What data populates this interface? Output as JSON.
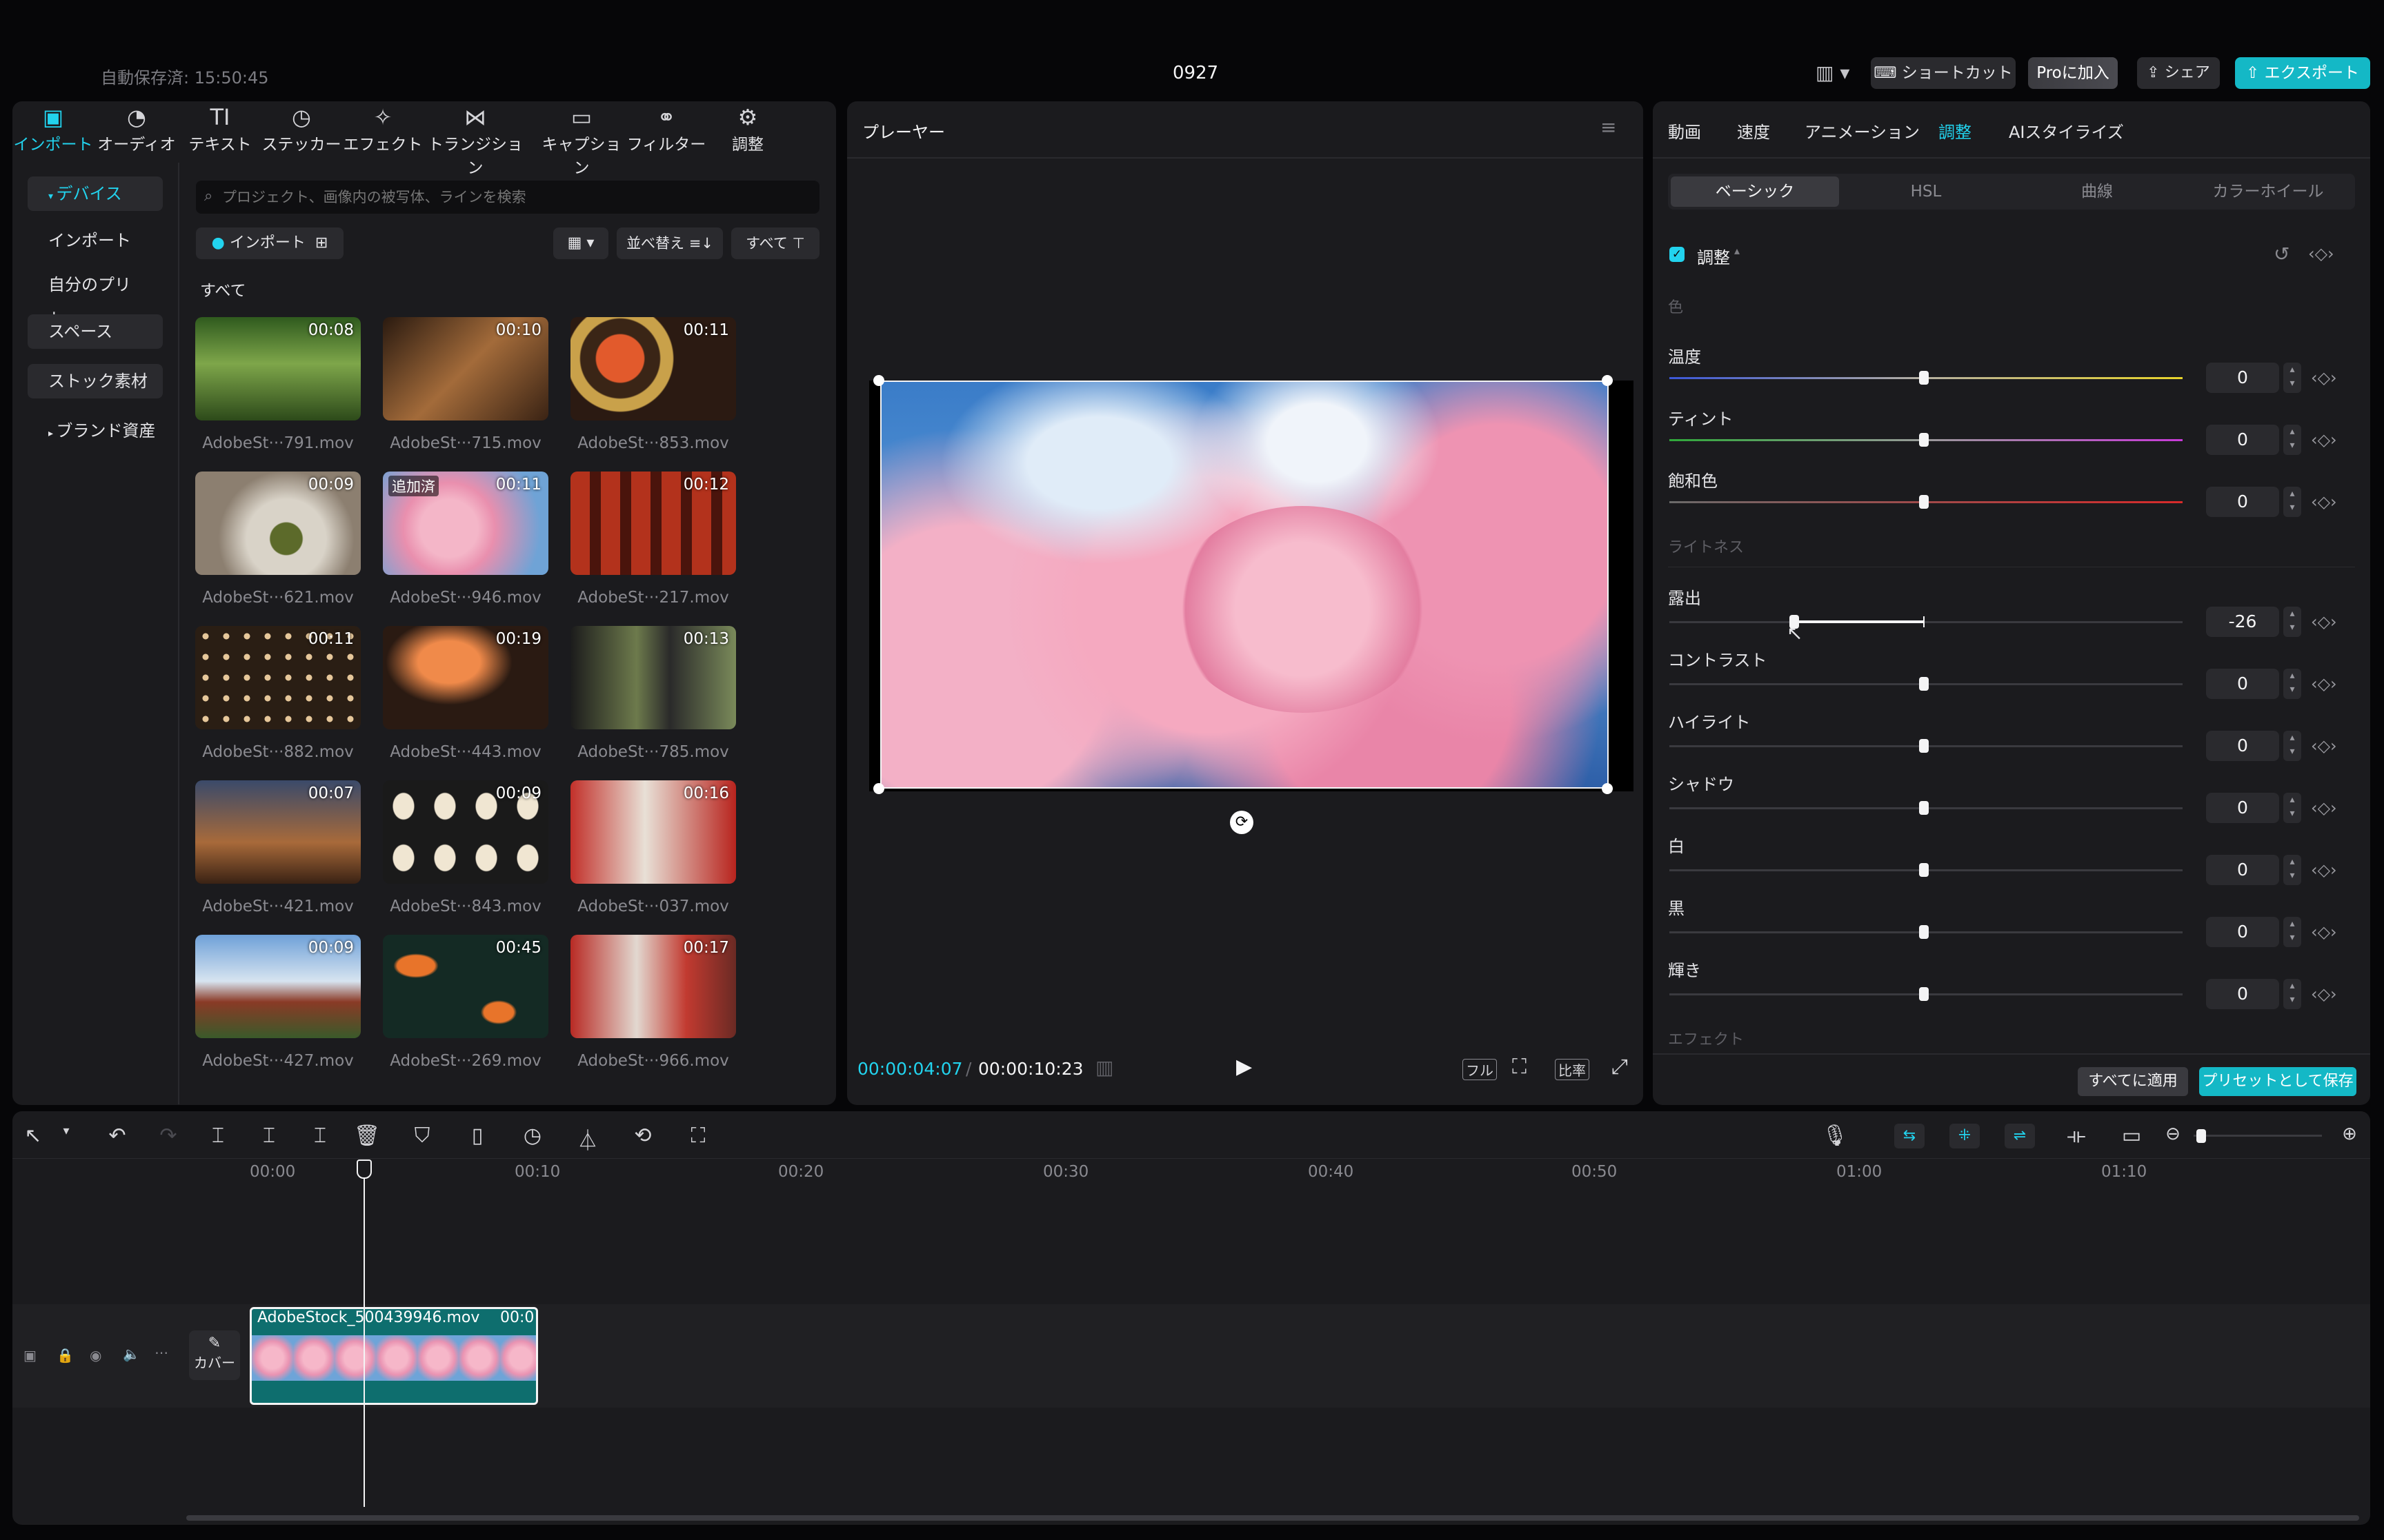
{
  "topbar": {
    "autosave": "自動保存済: 15:50:45",
    "project_name": "0927",
    "shortcut_label": "ショートカット",
    "pro_label": "Proに加入",
    "share_label": "シェア",
    "export_label": "エクスポート"
  },
  "tool_tabs": [
    {
      "label": "インポート",
      "icon": "import-icon"
    },
    {
      "label": "オーディオ",
      "icon": "audio-icon"
    },
    {
      "label": "テキスト",
      "icon": "text-icon"
    },
    {
      "label": "ステッカー",
      "icon": "sticker-icon"
    },
    {
      "label": "エフェクト",
      "icon": "effects-icon"
    },
    {
      "label": "トランジション",
      "icon": "transition-icon"
    },
    {
      "label": "キャプション",
      "icon": "caption-icon"
    },
    {
      "label": "フィルター",
      "icon": "filter-icon"
    },
    {
      "label": "調整",
      "icon": "adjust-icon"
    }
  ],
  "sidebar": {
    "items": [
      {
        "label": "デバイス"
      },
      {
        "label": "インポート"
      },
      {
        "label": "自分のプリセ…"
      },
      {
        "label": "スペース"
      },
      {
        "label": "ストック素材"
      },
      {
        "label": "ブランド資産"
      }
    ]
  },
  "media": {
    "search_placeholder": "プロジェクト、画像内の被写体、ラインを検索",
    "import_label": "インポート",
    "sort_label": "並べ替え",
    "filter_label": "すべて",
    "section_title": "すべて",
    "added_badge": "追加済",
    "items": [
      {
        "name": "AdobeSt···791.mov",
        "duration": "00:08"
      },
      {
        "name": "AdobeSt···715.mov",
        "duration": "00:10"
      },
      {
        "name": "AdobeSt···853.mov",
        "duration": "00:11"
      },
      {
        "name": "AdobeSt···621.mov",
        "duration": "00:09"
      },
      {
        "name": "AdobeSt···946.mov",
        "duration": "00:11"
      },
      {
        "name": "AdobeSt···217.mov",
        "duration": "00:12"
      },
      {
        "name": "AdobeSt···882.mov",
        "duration": "00:11"
      },
      {
        "name": "AdobeSt···443.mov",
        "duration": "00:19"
      },
      {
        "name": "AdobeSt···785.mov",
        "duration": "00:13"
      },
      {
        "name": "AdobeSt···421.mov",
        "duration": "00:07"
      },
      {
        "name": "AdobeSt···843.mov",
        "duration": "00:09"
      },
      {
        "name": "AdobeSt···037.mov",
        "duration": "00:16"
      },
      {
        "name": "AdobeSt···427.mov",
        "duration": "00:09"
      },
      {
        "name": "AdobeSt···269.mov",
        "duration": "00:45"
      },
      {
        "name": "AdobeSt···966.mov",
        "duration": "00:17"
      }
    ]
  },
  "player": {
    "title": "プレーヤー",
    "current_time": "00:00:04:07",
    "total_time": "00:00:10:23",
    "full_label": "フル",
    "ratio_label": "比率"
  },
  "inspector": {
    "tabs": [
      "動画",
      "速度",
      "アニメーション",
      "調整",
      "AIスタイライズ"
    ],
    "active_tab": "調整",
    "subtabs": [
      "ベーシック",
      "HSL",
      "曲線",
      "カラーホイール"
    ],
    "active_subtab": "ベーシック",
    "adjust_title": "調整",
    "section_color": "色",
    "section_lightness": "ライトネス",
    "section_effect": "エフェクト",
    "sliders": [
      {
        "label": "温度",
        "value": "0"
      },
      {
        "label": "ティント",
        "value": "0"
      },
      {
        "label": "飽和色",
        "value": "0"
      },
      {
        "label": "露出",
        "value": "-26"
      },
      {
        "label": "コントラスト",
        "value": "0"
      },
      {
        "label": "ハイライト",
        "value": "0"
      },
      {
        "label": "シャドウ",
        "value": "0"
      },
      {
        "label": "白",
        "value": "0"
      },
      {
        "label": "黒",
        "value": "0"
      },
      {
        "label": "輝き",
        "value": "0"
      }
    ],
    "apply_all_label": "すべてに適用",
    "save_preset_label": "プリセットとして保存"
  },
  "timeline": {
    "ruler": [
      "00:00",
      "00:10",
      "00:20",
      "00:30",
      "00:40",
      "00:50",
      "01:00",
      "01:10"
    ],
    "clip_name": "AdobeStock_500439946.mov",
    "clip_duration": "00:0",
    "cover_label": "カバー"
  },
  "colors": {
    "accent": "#22d3ee",
    "panel": "#1b1b1e",
    "clip": "#0e6e6e"
  }
}
